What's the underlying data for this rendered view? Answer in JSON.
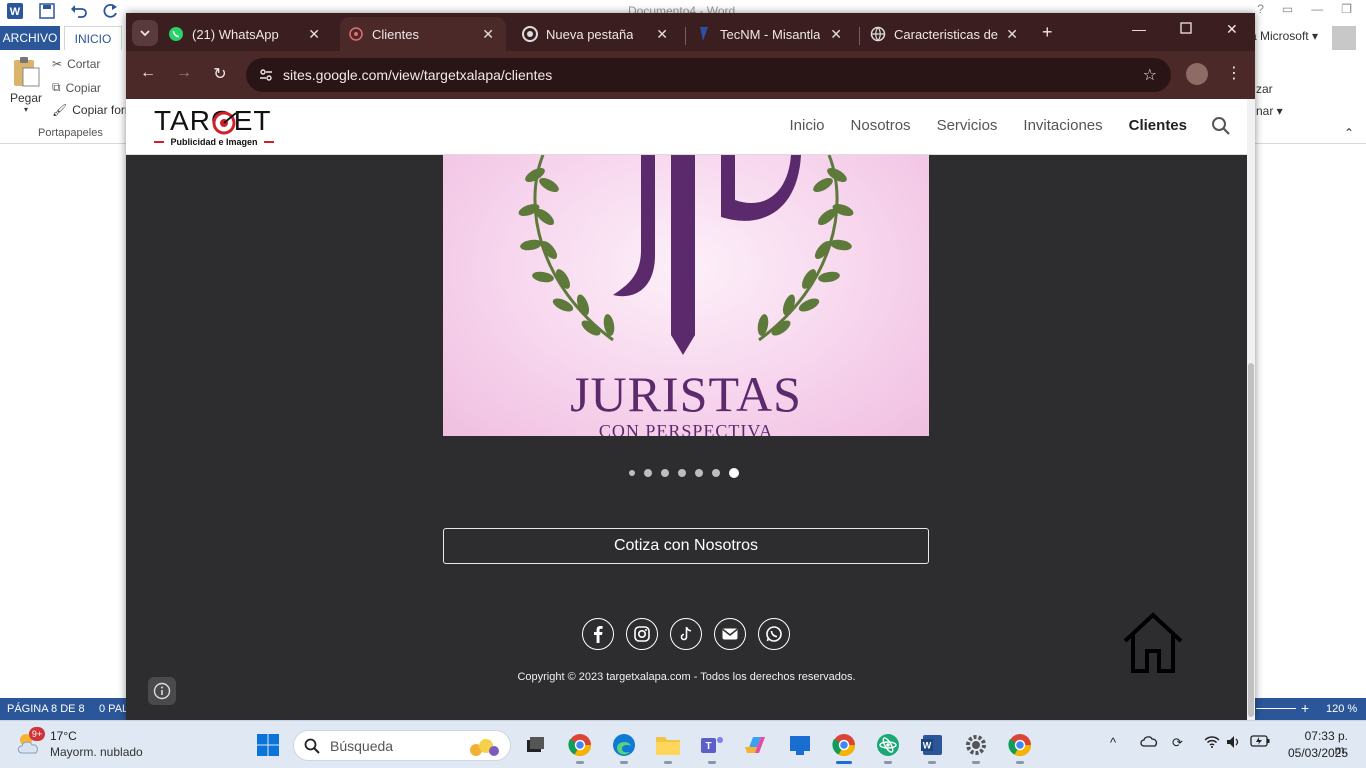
{
  "word": {
    "title": "Documento4 - Word",
    "tab_archivo": "ARCHIVO",
    "tab_inicio": "INICIO",
    "account": "a Microsoft",
    "ribbon": {
      "paste": "Pegar",
      "cut": "Cortar",
      "copy": "Copiar",
      "format_painter": "Copiar forr",
      "group_label": "Portapapeles",
      "right1": "zar",
      "right2": "nar"
    },
    "status": {
      "page": "PÁGINA 8 DE 8",
      "words": "0 PAL",
      "zoom": "120 %"
    }
  },
  "chrome": {
    "tabs": [
      {
        "label": "(21) WhatsApp",
        "icon": "whatsapp-icon"
      },
      {
        "label": "Clientes",
        "icon": "target-favicon",
        "active": true
      },
      {
        "label": "Nueva pestaña",
        "icon": "chrome-icon"
      },
      {
        "label": "TecNM - Misantla",
        "icon": "tecnm-icon"
      },
      {
        "label": "Caracteristicas de p",
        "icon": "globe-icon"
      }
    ],
    "url": "sites.google.com/view/targetxalapa/clientes"
  },
  "site": {
    "logo_title": "TARGET",
    "logo_sub": "Publicidad e Imagen",
    "nav": [
      {
        "label": "Inicio"
      },
      {
        "label": "Nosotros"
      },
      {
        "label": "Servicios"
      },
      {
        "label": "Invitaciones"
      },
      {
        "label": "Clientes",
        "active": true
      }
    ],
    "slide": {
      "title": "JURISTAS",
      "subtitle": "CON PERSPECTIVA",
      "dots_total": 7,
      "dots_active_index": 6
    },
    "cta": "Cotiza con Nosotros",
    "socials": [
      "facebook-icon",
      "instagram-icon",
      "tiktok-icon",
      "email-icon",
      "whatsapp-icon"
    ],
    "copyright": "Copyright © 2023 targetxalapa.com - Todos los derechos reservados."
  },
  "taskbar": {
    "weather_badge": "9+",
    "weather_temp": "17°C",
    "weather_desc": "Mayorm. nublado",
    "search_placeholder": "Búsqueda",
    "time": "07:33 p. m.",
    "date": "05/03/2025"
  },
  "colors": {
    "word_blue": "#2b579a",
    "chrome_frame": "#3b1e20",
    "chrome_toolbar": "#4b2929",
    "site_bg": "#2d2d2f",
    "slide_text": "#5b2a6d",
    "laurel": "#5d7a3a",
    "logo_red": "#d0202a"
  }
}
